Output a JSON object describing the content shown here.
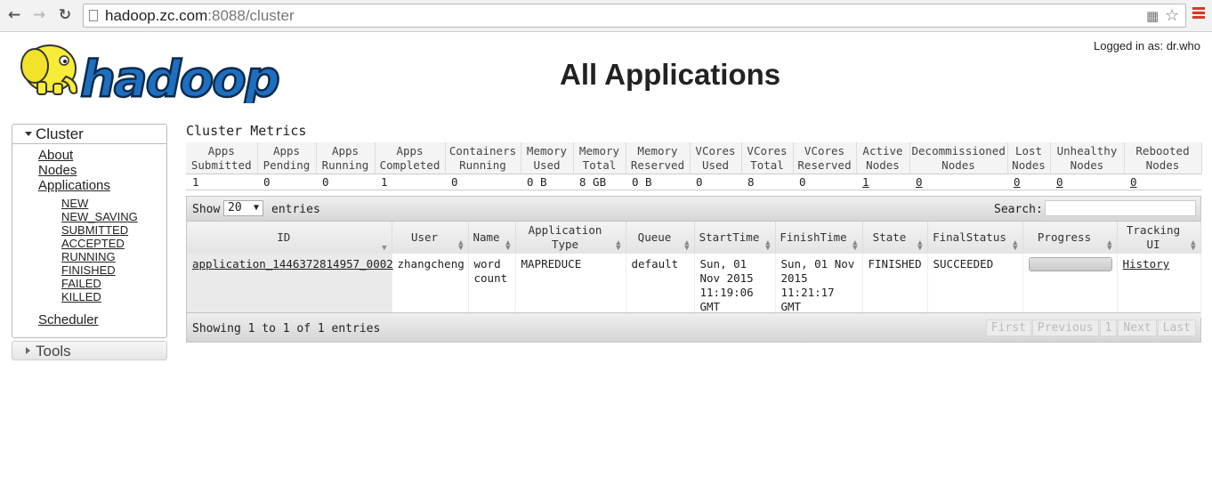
{
  "browser": {
    "url_host": "hadoop.zc.com",
    "url_rest": ":8088/cluster",
    "icons": [
      "back-arrow-icon",
      "forward-arrow-icon",
      "reload-icon",
      "page-icon",
      "translate-icon",
      "star-icon",
      "menu-icon"
    ]
  },
  "header": {
    "logged_in": "Logged in as: dr.who",
    "title": "All Applications",
    "logo_text": "hadoop"
  },
  "sidebar": {
    "cluster_label": "Cluster",
    "links": [
      "About",
      "Nodes",
      "Applications"
    ],
    "states": [
      "NEW",
      "NEW_SAVING",
      "SUBMITTED",
      "ACCEPTED",
      "RUNNING",
      "FINISHED",
      "FAILED",
      "KILLED"
    ],
    "scheduler": "Scheduler",
    "tools_label": "Tools"
  },
  "metrics": {
    "title": "Cluster Metrics",
    "headers": [
      [
        "Apps",
        "Submitted"
      ],
      [
        "Apps",
        "Pending"
      ],
      [
        "Apps",
        "Running"
      ],
      [
        "Apps",
        "Completed"
      ],
      [
        "Containers",
        "Running"
      ],
      [
        "Memory",
        "Used"
      ],
      [
        "Memory",
        "Total"
      ],
      [
        "Memory",
        "Reserved"
      ],
      [
        "VCores",
        "Used"
      ],
      [
        "VCores",
        "Total"
      ],
      [
        "VCores",
        "Reserved"
      ],
      [
        "Active",
        "Nodes"
      ],
      [
        "Decommissioned",
        "Nodes"
      ],
      [
        "Lost",
        "Nodes"
      ],
      [
        "Unhealthy",
        "Nodes"
      ],
      [
        "Rebooted",
        "Nodes"
      ]
    ],
    "values": [
      "1",
      "0",
      "0",
      "1",
      "0",
      "0 B",
      "8 GB",
      "0 B",
      "0",
      "8",
      "0",
      "1",
      "0",
      "0",
      "0",
      "0"
    ]
  },
  "apps": {
    "show_label": "Show",
    "page_size": "20",
    "entries_label": "entries",
    "search_label": "Search:",
    "search_value": "",
    "columns": [
      [
        "ID"
      ],
      [
        "User"
      ],
      [
        "Name"
      ],
      [
        "Application",
        "Type"
      ],
      [
        "Queue"
      ],
      [
        "StartTime"
      ],
      [
        "FinishTime"
      ],
      [
        "State"
      ],
      [
        "FinalStatus"
      ],
      [
        "Progress"
      ],
      [
        "Tracking",
        "UI"
      ]
    ],
    "rows": [
      {
        "id": "application_1446372814957_0002",
        "user": "zhangcheng",
        "name": "word count",
        "type": "MAPREDUCE",
        "queue": "default",
        "start": "Sun, 01 Nov 2015 11:19:06 GMT",
        "finish": "Sun, 01 Nov 2015 11:21:17 GMT",
        "state": "FINISHED",
        "final_status": "SUCCEEDED",
        "progress": 100,
        "tracking": "History"
      }
    ],
    "info": "Showing 1 to 1 of 1 entries",
    "pager": [
      "First",
      "Previous",
      "1",
      "Next",
      "Last"
    ]
  }
}
